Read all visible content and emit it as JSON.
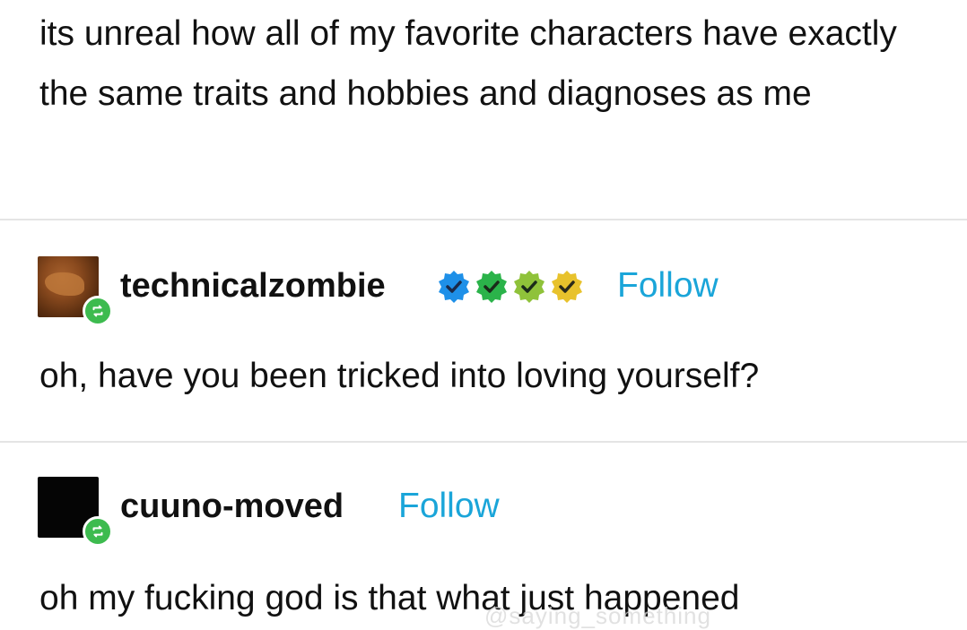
{
  "original_post": {
    "text": "its unreal how all of my favorite characters have exactly the same traits and hobbies and diagnoses as me"
  },
  "replies": [
    {
      "username": "technicalzombie",
      "follow_label": "Follow",
      "badges": [
        {
          "icon": "verified-check-icon",
          "color": "#1e90e8"
        },
        {
          "icon": "verified-check-icon",
          "color": "#2bb34a"
        },
        {
          "icon": "verified-check-icon",
          "color": "#8fc23a"
        },
        {
          "icon": "verified-check-icon",
          "color": "#e8c22c"
        }
      ],
      "text": "oh, have you been tricked into loving yourself?"
    },
    {
      "username": "cuuno-moved",
      "follow_label": "Follow",
      "text": "oh my fucking god is that what just happened"
    }
  ],
  "colors": {
    "follow": "#1aa5d9",
    "reblog_badge": "#3dbb4f",
    "divider": "#e4e4e4"
  },
  "watermark": "@saying_something"
}
